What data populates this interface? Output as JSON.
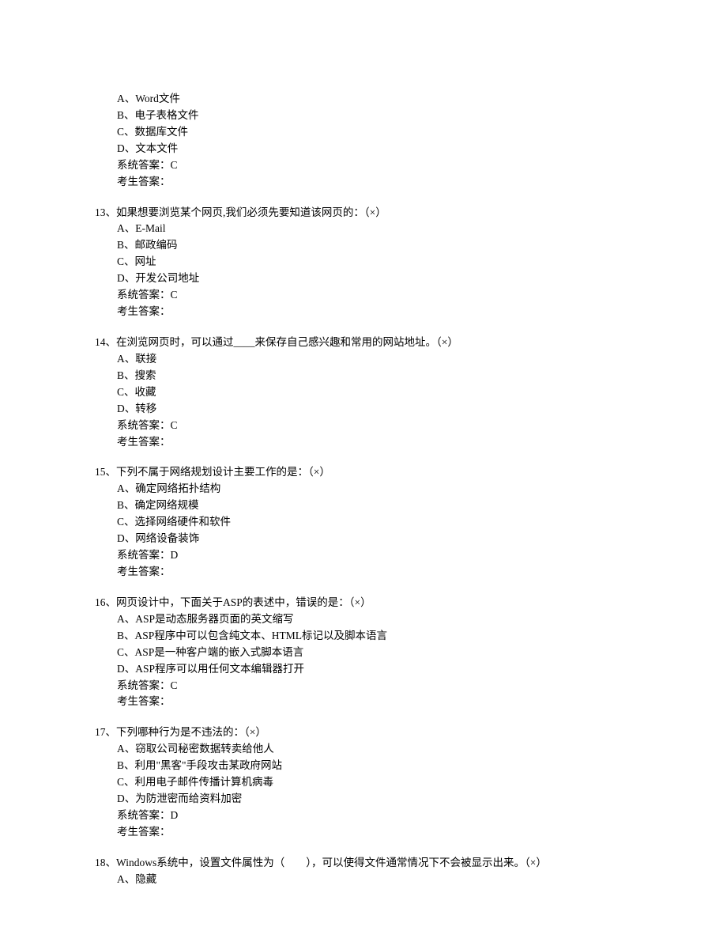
{
  "orphan": {
    "options": [
      "A、Word文件",
      "B、电子表格文件",
      "C、数据库文件",
      "D、文本文件"
    ],
    "systemAnswer": "系统答案：C",
    "examineeAnswer": "考生答案："
  },
  "questions": [
    {
      "stem": "13、如果想要浏览某个网页,我们必须先要知道该网页的：（×）",
      "options": [
        "A、E-Mail",
        "B、邮政编码",
        "C、网址",
        "D、开发公司地址"
      ],
      "systemAnswer": "系统答案：C",
      "examineeAnswer": "考生答案："
    },
    {
      "stem": "14、在浏览网页时，可以通过____来保存自己感兴趣和常用的网站地址。（×）",
      "options": [
        "A、联接",
        "B、搜索",
        "C、收藏",
        "D、转移"
      ],
      "systemAnswer": "系统答案：C",
      "examineeAnswer": "考生答案："
    },
    {
      "stem": "15、下列不属于网络规划设计主要工作的是：（×）",
      "options": [
        "A、确定网络拓扑结构",
        "B、确定网络规模",
        "C、选择网络硬件和软件",
        "D、网络设备装饰"
      ],
      "systemAnswer": "系统答案：D",
      "examineeAnswer": "考生答案："
    },
    {
      "stem": "16、网页设计中，下面关于ASP的表述中，错误的是：（×）",
      "options": [
        "A、ASP是动态服务器页面的英文缩写",
        "B、ASP程序中可以包含纯文本、HTML标记以及脚本语言",
        "C、ASP是一种客户端的嵌入式脚本语言",
        "D、ASP程序可以用任何文本编辑器打开"
      ],
      "systemAnswer": "系统答案：C",
      "examineeAnswer": "考生答案："
    },
    {
      "stem": "17、下列哪种行为是不违法的：（×）",
      "options": [
        "A、窃取公司秘密数据转卖给他人",
        "B、利用\"黑客\"手段攻击某政府网站",
        "C、利用电子邮件传播计算机病毒",
        "D、为防泄密而给资料加密"
      ],
      "systemAnswer": "系统答案：D",
      "examineeAnswer": "考生答案："
    },
    {
      "stem": "18、Windows系统中，设置文件属性为（　　），可以使得文件通常情况下不会被显示出来。（×）",
      "options": [
        "A、隐藏"
      ],
      "systemAnswer": "",
      "examineeAnswer": ""
    }
  ]
}
